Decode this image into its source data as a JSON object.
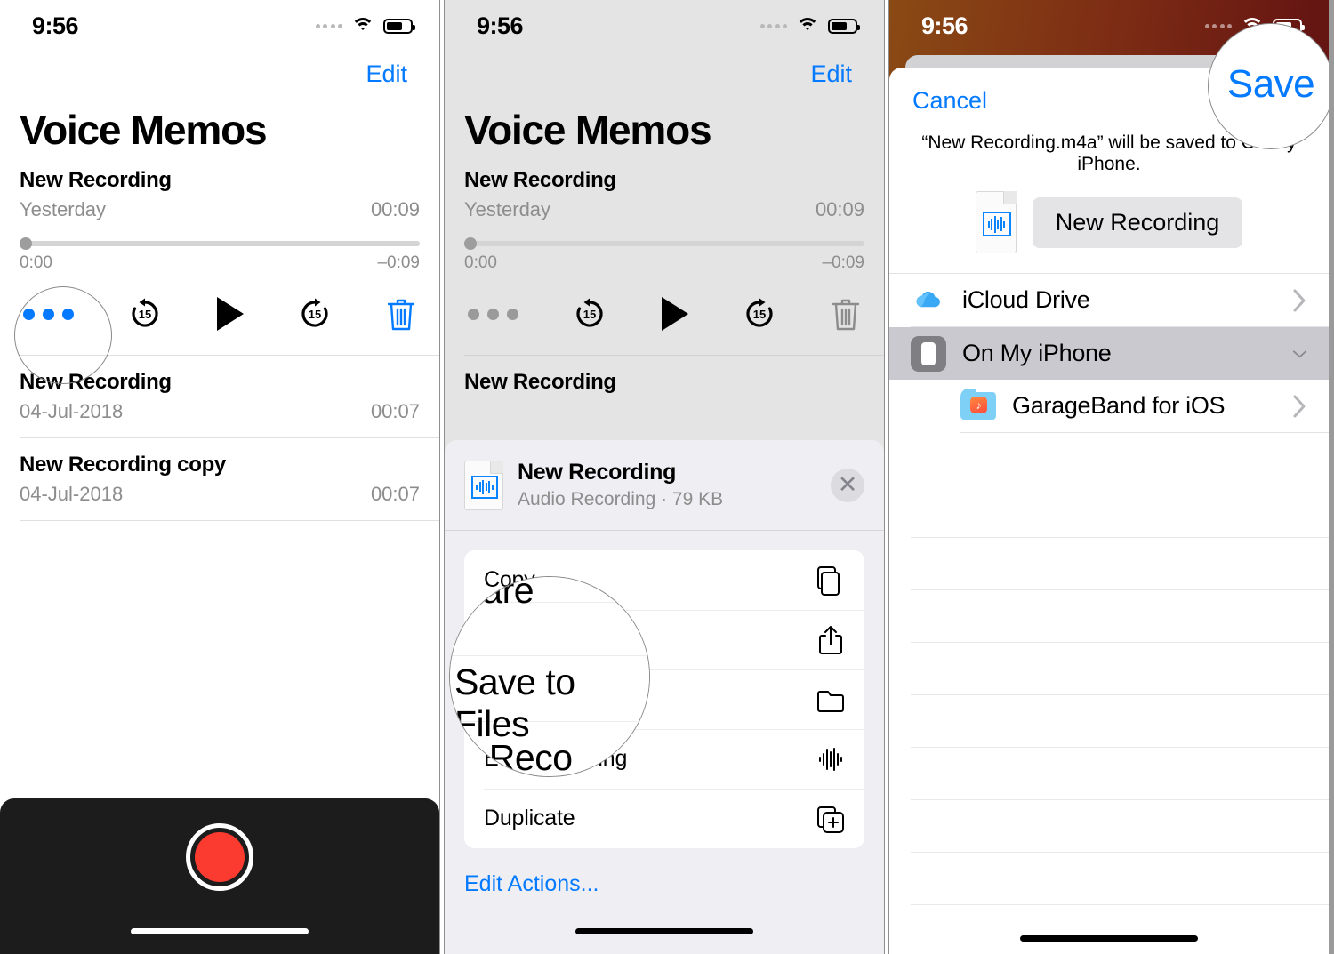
{
  "status_bar": {
    "time": "9:56",
    "cellular_icon": "cellular-dots-icon",
    "wifi_icon": "wifi-icon",
    "battery_icon": "battery-icon"
  },
  "panel1": {
    "edit_label": "Edit",
    "title": "Voice Memos",
    "selected_memo": {
      "name": "New Recording",
      "date": "Yesterday",
      "duration": "00:09",
      "elapsed": "0:00",
      "remaining": "–0:09"
    },
    "controls": {
      "more_label": "more-options",
      "skip_back_label": "15",
      "play_label": "play",
      "skip_forward_label": "15",
      "delete_label": "delete"
    },
    "memos": [
      {
        "name": "New Recording",
        "date": "04-Jul-2018",
        "duration": "00:07"
      },
      {
        "name": "New Recording copy",
        "date": "04-Jul-2018",
        "duration": "00:07"
      }
    ],
    "record_button_label": "Record"
  },
  "panel2": {
    "edit_label": "Edit",
    "title": "Voice Memos",
    "selected_memo": {
      "name": "New Recording",
      "date": "Yesterday",
      "duration": "00:09",
      "elapsed": "0:00",
      "remaining": "–0:09"
    },
    "background_memo": {
      "name": "New Recording"
    },
    "share_sheet": {
      "file_name": "New Recording",
      "file_meta": "Audio Recording · 79 KB",
      "close_label": "✕",
      "actions": [
        {
          "label": "Copy",
          "icon": "copy-icon"
        },
        {
          "label": "Share",
          "icon": "share-icon"
        },
        {
          "label": "Save to Files",
          "icon": "folder-icon"
        },
        {
          "label": "Edit Recording",
          "icon": "waveform-icon"
        },
        {
          "label": "Duplicate",
          "icon": "duplicate-icon"
        }
      ],
      "edit_actions_label": "Edit Actions..."
    },
    "loupe_text": "Save to Files"
  },
  "panel3": {
    "cancel_label": "Cancel",
    "save_label": "Save",
    "description": "“New Recording.m4a” will be saved to On My iPhone.",
    "file_name_chip": "New Recording",
    "locations": [
      {
        "label": "iCloud Drive",
        "icon": "icloud-icon",
        "chevron": "chevron-right-icon",
        "selected": false,
        "indent": false
      },
      {
        "label": "On My iPhone",
        "icon": "iphone-icon",
        "chevron": "chevron-down-icon",
        "selected": true,
        "indent": false
      },
      {
        "label": "GarageBand for iOS",
        "icon": "folder-garageband-icon",
        "chevron": "chevron-right-icon",
        "selected": false,
        "indent": true
      }
    ],
    "loupe_text": "Save"
  },
  "colors": {
    "accent_blue": "#037aff",
    "record_red": "#fb3b30",
    "dim_gray": "#e4e4e4",
    "selected_row": "#c9c9cf"
  }
}
